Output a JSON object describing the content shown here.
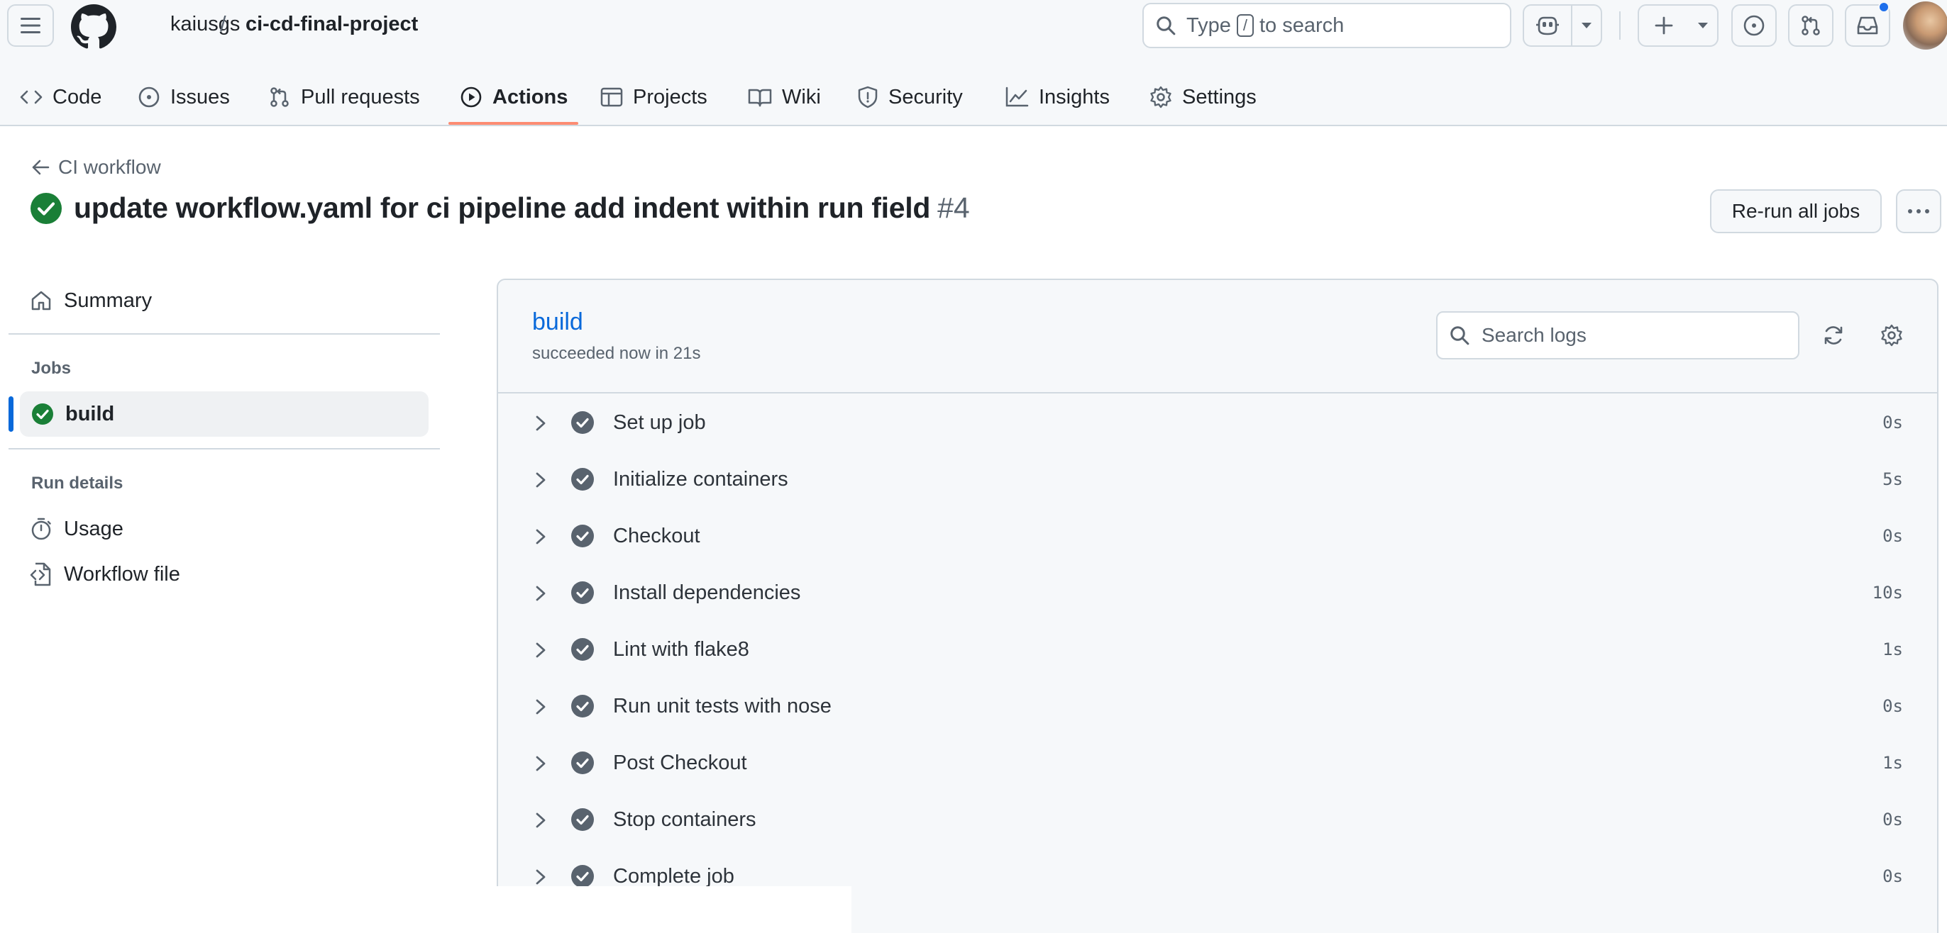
{
  "header": {
    "owner": "kaiusgs",
    "separator": "/",
    "repo": "ci-cd-final-project",
    "search": {
      "prefix": "Type",
      "key": "/",
      "suffix": "to search"
    }
  },
  "repo_nav": {
    "tabs": [
      {
        "label": "Code",
        "icon": "code-icon"
      },
      {
        "label": "Issues",
        "icon": "issue-opened-icon"
      },
      {
        "label": "Pull requests",
        "icon": "git-pull-request-icon"
      },
      {
        "label": "Actions",
        "icon": "play-icon",
        "active": true
      },
      {
        "label": "Projects",
        "icon": "table-icon"
      },
      {
        "label": "Wiki",
        "icon": "book-icon"
      },
      {
        "label": "Security",
        "icon": "shield-icon"
      },
      {
        "label": "Insights",
        "icon": "graph-icon"
      },
      {
        "label": "Settings",
        "icon": "gear-icon"
      }
    ]
  },
  "run": {
    "back_label": "CI workflow",
    "title": "update workflow.yaml for ci pipeline add indent within run field",
    "number": "#4",
    "rerun_label": "Re-run all jobs",
    "status_color": "#1a7f37"
  },
  "sidebar": {
    "summary_label": "Summary",
    "jobs_heading": "Jobs",
    "job_label": "build",
    "run_details_heading": "Run details",
    "usage_label": "Usage",
    "workflow_file_label": "Workflow file"
  },
  "job": {
    "name": "build",
    "status": "succeeded now in 21s",
    "search_placeholder": "Search logs",
    "steps": [
      {
        "label": "Set up job",
        "duration": "0s"
      },
      {
        "label": "Initialize containers",
        "duration": "5s"
      },
      {
        "label": "Checkout",
        "duration": "0s"
      },
      {
        "label": "Install dependencies",
        "duration": "10s"
      },
      {
        "label": "Lint with flake8",
        "duration": "1s"
      },
      {
        "label": "Run unit tests with nose",
        "duration": "0s"
      },
      {
        "label": "Post Checkout",
        "duration": "1s"
      },
      {
        "label": "Stop containers",
        "duration": "0s"
      },
      {
        "label": "Complete job",
        "duration": "0s"
      }
    ]
  },
  "colors": {
    "accent_link": "#0969da",
    "success": "#1a7f37",
    "active_tab_underline": "#fd8c73",
    "notification_dot": "#1f6feb"
  }
}
